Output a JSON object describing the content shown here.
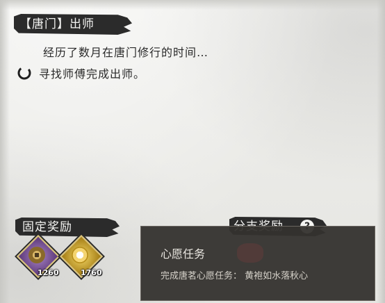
{
  "quest": {
    "title": "【唐门】出师",
    "description": "经历了数月在唐门修行的时间…",
    "objective": "寻找师傅完成出师。"
  },
  "rewards": {
    "fixed_label": "固定奖励",
    "branch_label": "分支奖励",
    "help_icon": "?",
    "items": [
      {
        "icon": "copper-coin-icon",
        "count": "1260"
      },
      {
        "icon": "gold-lotus-icon",
        "count": "1760"
      }
    ]
  },
  "tooltip": {
    "title": "心愿任务",
    "body": "完成唐茗心愿任务：  黄袍如水落秋心"
  }
}
